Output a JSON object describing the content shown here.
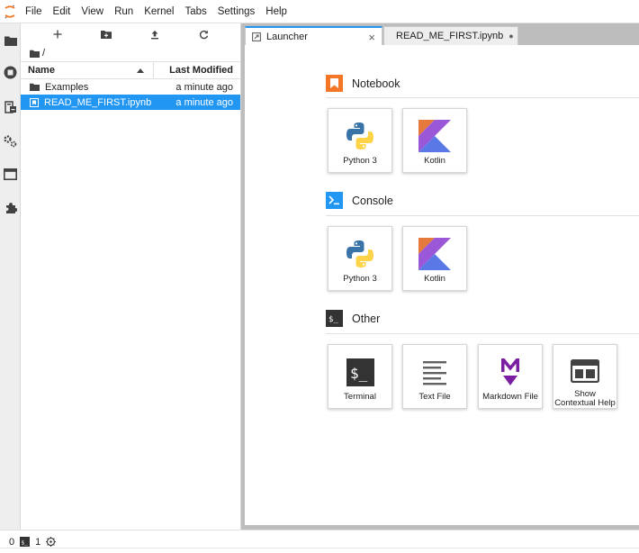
{
  "menubar": {
    "items": [
      "File",
      "Edit",
      "View",
      "Run",
      "Kernel",
      "Tabs",
      "Settings",
      "Help"
    ]
  },
  "activity_icons": [
    "folder-icon",
    "running-icon",
    "commands-icon",
    "property-inspector-icon",
    "tabs-icon",
    "extension-icon"
  ],
  "filebrowser": {
    "path": "/",
    "columns": {
      "name": "Name",
      "modified": "Last Modified"
    },
    "rows": [
      {
        "name": "Examples",
        "modified": "a minute ago",
        "type": "folder",
        "selected": false
      },
      {
        "name": "READ_ME_FIRST.ipynb",
        "modified": "a minute ago",
        "type": "notebook",
        "selected": true
      }
    ]
  },
  "tabs": [
    {
      "label": "Launcher",
      "active": true,
      "close": "×"
    },
    {
      "label": "READ_ME_FIRST.ipynb",
      "active": false,
      "close": "●"
    }
  ],
  "launcher": {
    "sections": [
      {
        "title": "Notebook",
        "cards": [
          "Python 3",
          "Kotlin"
        ]
      },
      {
        "title": "Console",
        "cards": [
          "Python 3",
          "Kotlin"
        ]
      },
      {
        "title": "Other",
        "cards": [
          "Terminal",
          "Text File",
          "Markdown File",
          "Show Contextual Help"
        ]
      }
    ],
    "contextual_help_line1": "Show",
    "contextual_help_line2": "Contextual Help"
  },
  "statusbar": {
    "count_left": "0",
    "terminal_count": "1"
  },
  "colors": {
    "accent": "#2196f3",
    "notebook_orange": "#f37726",
    "console_blue": "#2196f3",
    "other_dark": "#333333",
    "markdown_purple": "#7b1fa2"
  }
}
